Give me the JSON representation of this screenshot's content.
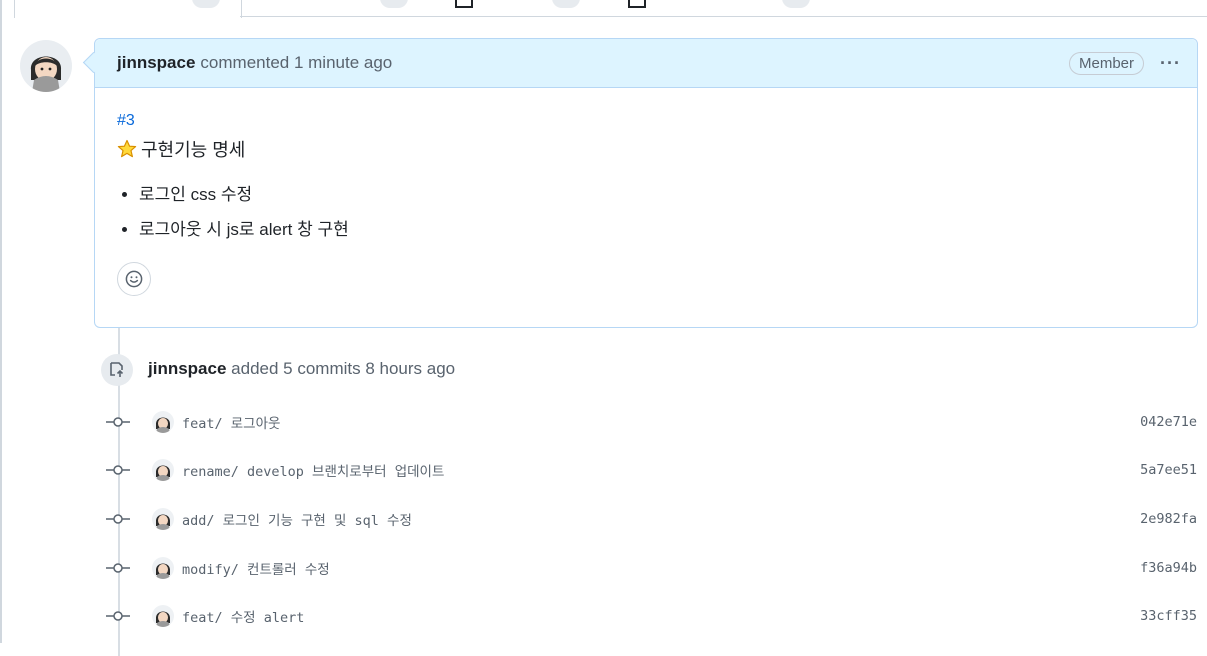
{
  "comment": {
    "author": "jinnspace",
    "action": "commented 1 minute ago",
    "badge": "Member",
    "menu": "···",
    "body": {
      "issue_ref": "#3",
      "heading": "구현기능 명세",
      "items": [
        "로그인 css 수정",
        "로그아웃 시 js로 alert 창 구현"
      ]
    }
  },
  "event": {
    "author": "jinnspace",
    "text": "added 5 commits 8 hours ago"
  },
  "commits": [
    {
      "message": "feat/ 로그아웃",
      "sha": "042e71e"
    },
    {
      "message": "rename/ develop 브랜치로부터 업데이트",
      "sha": "5a7ee51"
    },
    {
      "message": "add/ 로그인 기능 구현 및 sql 수정",
      "sha": "2e982fa"
    },
    {
      "message": "modify/ 컨트롤러 수정",
      "sha": "f36a94b"
    },
    {
      "message": "feat/ 수정 alert",
      "sha": "33cff35"
    }
  ],
  "icons": {
    "star": "star-icon",
    "smiley": "smiley-icon",
    "commit_event": "git-commit-push-icon",
    "commit_node": "git-commit-icon",
    "kebab": "kebab-horizontal-icon"
  },
  "colors": {
    "link": "#0969da",
    "header_bg": "#ddf4ff",
    "border": "#d0d7de",
    "muted": "#59636e"
  }
}
